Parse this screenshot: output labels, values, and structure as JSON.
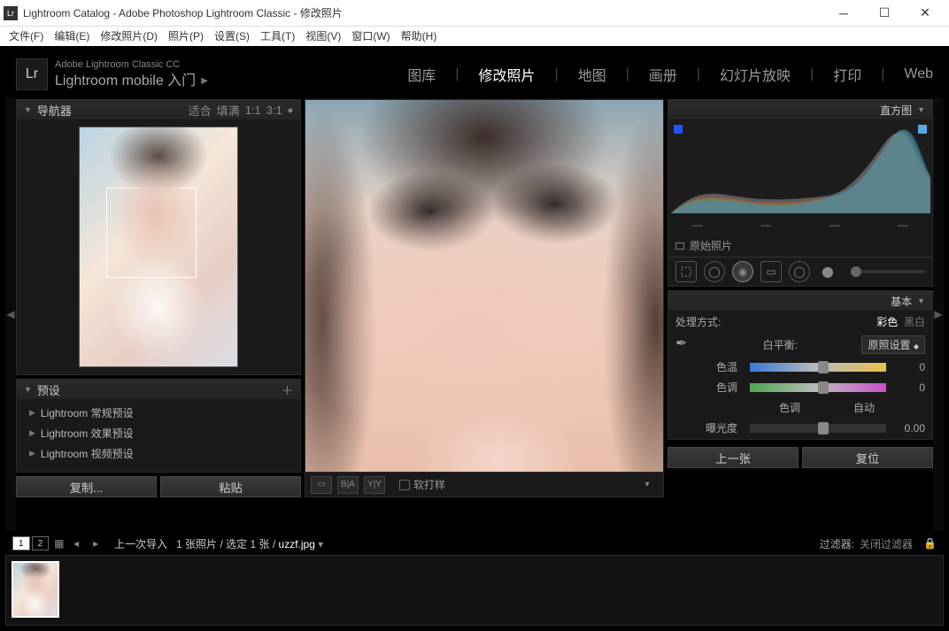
{
  "window": {
    "title": "Lightroom Catalog - Adobe Photoshop Lightroom Classic - 修改照片"
  },
  "menus": {
    "file": "文件(F)",
    "edit": "编辑(E)",
    "develop": "修改照片(D)",
    "photo": "照片(P)",
    "settings": "设置(S)",
    "tools": "工具(T)",
    "view": "视图(V)",
    "window": "窗口(W)",
    "help": "帮助(H)"
  },
  "identity": {
    "line1": "Adobe Lightroom Classic CC",
    "line2": "Lightroom mobile 入门"
  },
  "modules": {
    "library": "图库",
    "develop": "修改照片",
    "map": "地图",
    "book": "画册",
    "slideshow": "幻灯片放映",
    "print": "打印",
    "web": "Web"
  },
  "navigator": {
    "title": "导航器",
    "fit": "适合",
    "fill": "填满",
    "one": "1:1",
    "three": "3:1"
  },
  "presets": {
    "title": "预设",
    "items": [
      "Lightroom 常规预设",
      "Lightroom 效果预设",
      "Lightroom 视频预设"
    ]
  },
  "buttons": {
    "copy": "复制...",
    "paste": "粘贴",
    "softproof": "软打样",
    "prev": "上一张",
    "reset": "复位"
  },
  "histogram": {
    "title": "直方图",
    "original": "原始照片"
  },
  "basic": {
    "title": "基本",
    "treatment": "处理方式:",
    "color": "彩色",
    "bw": "黑白",
    "wb": "白平衡:",
    "wbsel": "原照设置",
    "temp": "色温",
    "tint": "色调",
    "tonelabel": "色调",
    "auto": "自动",
    "exposure": "曝光度",
    "v0": "0",
    "v00": "0.00"
  },
  "status": {
    "v1": "1",
    "v2": "2",
    "lastimport": "上一次导入",
    "count": "1 张照片 / 选定 1 张 /",
    "filename": "uzzf.jpg",
    "filter": "过滤器:",
    "filtersel": "关闭过滤器"
  }
}
